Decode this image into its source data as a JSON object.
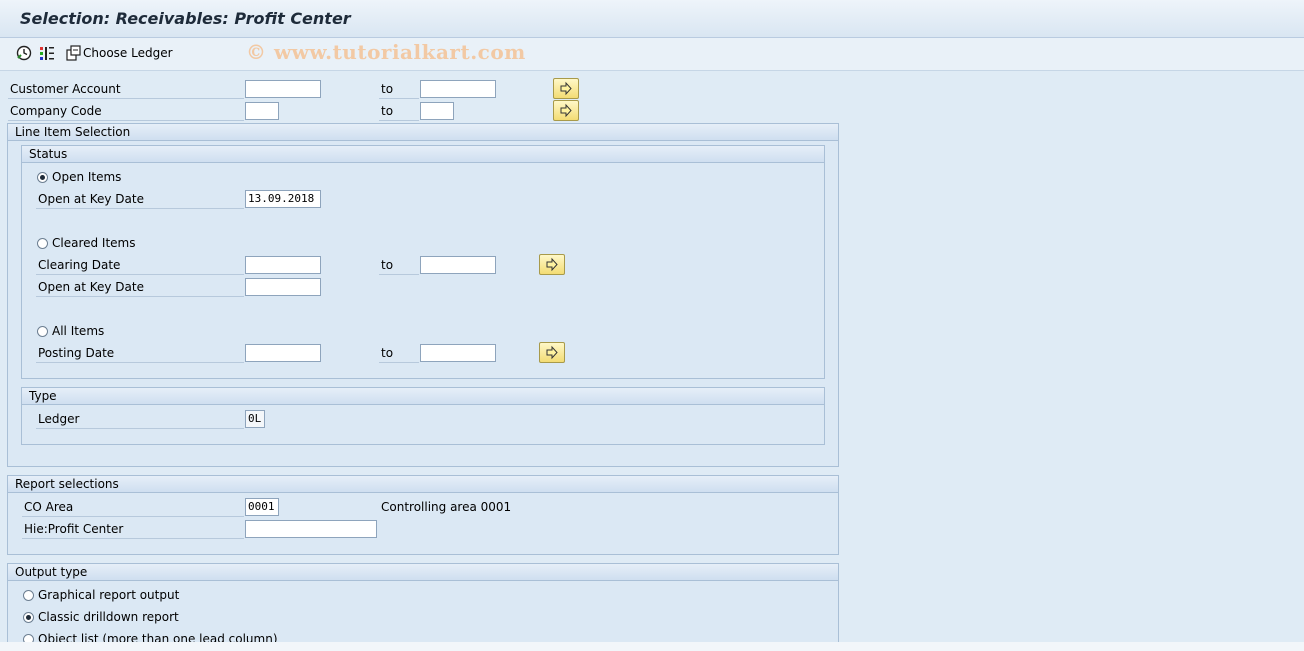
{
  "title": "Selection: Receivables: Profit Center",
  "toolbar": {
    "execute_icon": "clock-execute-icon",
    "variant_icon": "selection-options-icon",
    "choose_ledger_label": "Choose Ledger"
  },
  "watermark": "© www.tutorialkart.com",
  "top_fields": {
    "customer_account": {
      "label": "Customer Account",
      "to": "to",
      "from_value": "",
      "to_value": ""
    },
    "company_code": {
      "label": "Company Code",
      "to": "to",
      "from_value": "",
      "to_value": ""
    }
  },
  "line_item_selection": {
    "title": "Line Item Selection",
    "status": {
      "title": "Status",
      "open_items": {
        "label": "Open Items",
        "selected": true,
        "key_date_label": "Open at Key Date",
        "key_date_value": "13.09.2018"
      },
      "cleared_items": {
        "label": "Cleared Items",
        "selected": false,
        "clearing_date_label": "Clearing Date",
        "to": "to",
        "clearing_from": "",
        "clearing_to": "",
        "key_date_label": "Open at Key Date",
        "key_date_value": ""
      },
      "all_items": {
        "label": "All Items",
        "selected": false,
        "posting_date_label": "Posting Date",
        "to": "to",
        "posting_from": "",
        "posting_to": ""
      }
    },
    "type": {
      "title": "Type",
      "ledger_label": "Ledger",
      "ledger_value": "0L"
    }
  },
  "report_selections": {
    "title": "Report selections",
    "co_area_label": "CO Area",
    "co_area_value": "0001",
    "co_area_text": "Controlling area 0001",
    "profit_center_label": "Hie:Profit Center",
    "profit_center_value": ""
  },
  "output_type": {
    "title": "Output type",
    "options": [
      {
        "label": "Graphical report output",
        "selected": false
      },
      {
        "label": "Classic drilldown report",
        "selected": true
      },
      {
        "label": "Object list (more than one lead column)",
        "selected": false
      }
    ]
  },
  "colors": {
    "background": "#dfebf5",
    "button_yellow": "#f3dc74"
  }
}
